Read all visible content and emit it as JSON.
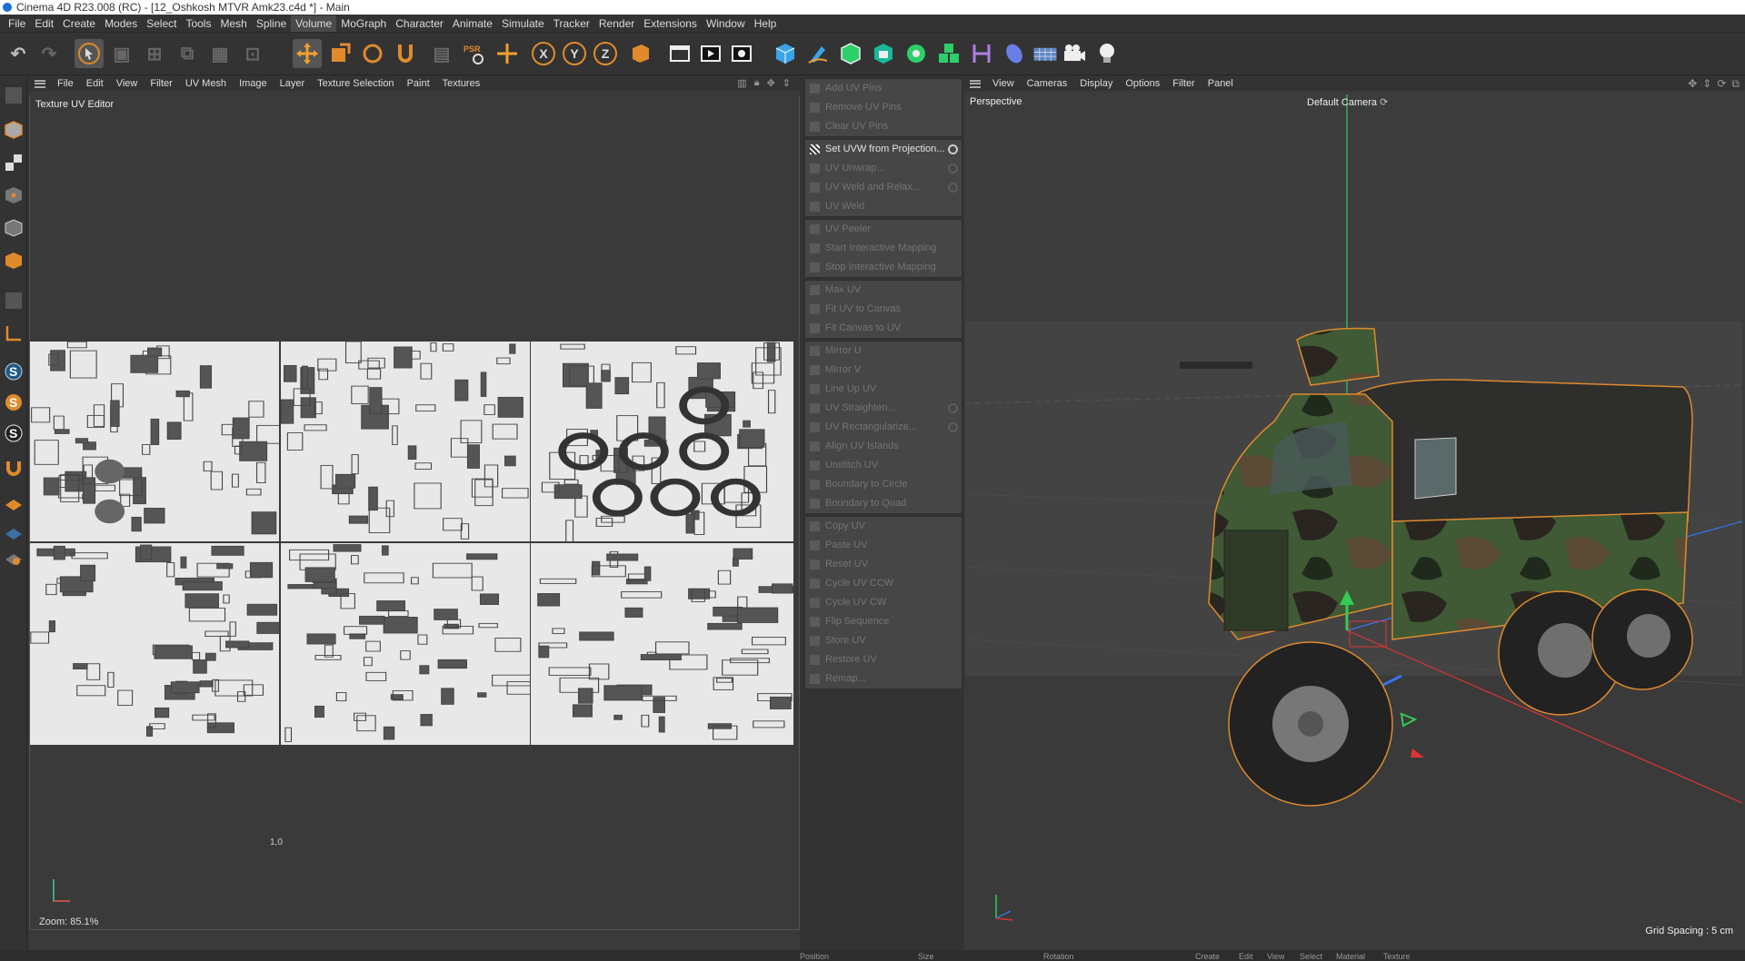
{
  "window": {
    "title": "Cinema 4D R23.008 (RC) - [12_Oshkosh MTVR Amk23.c4d *] - Main"
  },
  "menubar": {
    "items": [
      "File",
      "Edit",
      "Create",
      "Modes",
      "Select",
      "Tools",
      "Mesh",
      "Spline",
      "Volume",
      "MoGraph",
      "Character",
      "Animate",
      "Simulate",
      "Tracker",
      "Render",
      "Extensions",
      "Window",
      "Help"
    ],
    "active": "Volume"
  },
  "toolbar": {
    "axis_x": "X",
    "axis_y": "Y",
    "axis_z": "Z",
    "icons": [
      "undo-icon",
      "redo-icon",
      "live-selection-icon",
      "cube-mode-icon",
      "points-mode-icon",
      "edges-mode-icon",
      "polygons-mode-icon",
      "uv-mode-icon",
      "move-icon",
      "scale-icon",
      "rotate-icon",
      "snap-icon",
      "model-mode-icon",
      "psr-icon",
      "world-axis-icon",
      "render-region-icon",
      "render-view-icon",
      "render-settings-icon",
      "cube-icon",
      "pen-icon",
      "subdivision-icon",
      "extrude-icon",
      "cloner-icon",
      "mograph-icon",
      "deformer-icon",
      "field-icon",
      "floor-icon",
      "camera-icon",
      "light-icon"
    ]
  },
  "uv_editor": {
    "menu": [
      "File",
      "Edit",
      "View",
      "Filter",
      "UV Mesh",
      "Image",
      "Layer",
      "Texture Selection",
      "Paint",
      "Textures"
    ],
    "title": "Texture UV Editor",
    "coord_label": "1,0",
    "zoom": "Zoom: 85.1%"
  },
  "uv_commands": {
    "groups": [
      [
        {
          "label": "Add UV Pins",
          "enabled": false
        },
        {
          "label": "Remove UV Pins",
          "enabled": false
        },
        {
          "label": "Clear UV Pins",
          "enabled": false
        }
      ],
      [
        {
          "label": "Set UVW from Projection...",
          "enabled": true,
          "gear": true
        },
        {
          "label": "UV Unwrap...",
          "enabled": false,
          "gear": true
        },
        {
          "label": "UV Weld and Relax...",
          "enabled": false,
          "gear": true
        },
        {
          "label": "UV Weld",
          "enabled": false
        }
      ],
      [
        {
          "label": "UV Peeler",
          "enabled": false
        },
        {
          "label": "Start Interactive Mapping",
          "enabled": false
        },
        {
          "label": "Stop Interactive Mapping",
          "enabled": false
        }
      ],
      [
        {
          "label": "Max UV",
          "enabled": false
        },
        {
          "label": "Fit UV to Canvas",
          "enabled": false
        },
        {
          "label": "Fit Canvas to UV",
          "enabled": false
        }
      ],
      [
        {
          "label": "Mirror U",
          "enabled": false
        },
        {
          "label": "Mirror V",
          "enabled": false
        },
        {
          "label": "Line Up UV",
          "enabled": false
        },
        {
          "label": "UV Straighten...",
          "enabled": false,
          "gear": true
        },
        {
          "label": "UV Rectangularize...",
          "enabled": false,
          "gear": true
        },
        {
          "label": "Align UV Islands",
          "enabled": false
        },
        {
          "label": "Unstitch UV",
          "enabled": false
        },
        {
          "label": "Boundary to Circle",
          "enabled": false
        },
        {
          "label": "Boundary to Quad",
          "enabled": false
        }
      ],
      [
        {
          "label": "Copy UV",
          "enabled": false
        },
        {
          "label": "Paste UV",
          "enabled": false
        },
        {
          "label": "Reset UV",
          "enabled": false
        },
        {
          "label": "Cycle UV CCW",
          "enabled": false
        },
        {
          "label": "Cycle UV CW",
          "enabled": false
        },
        {
          "label": "Flip Sequence",
          "enabled": false
        },
        {
          "label": "Store UV",
          "enabled": false
        },
        {
          "label": "Restore UV",
          "enabled": false
        },
        {
          "label": "Remap...",
          "enabled": false
        }
      ]
    ]
  },
  "viewport": {
    "menu": [
      "View",
      "Cameras",
      "Display",
      "Options",
      "Filter",
      "Panel"
    ],
    "projection": "Perspective",
    "camera": "Default Camera",
    "grid_spacing": "Grid Spacing : 5 cm"
  },
  "statusbar": {
    "tabs": [
      "Position",
      "Size",
      "Rotation",
      "Create",
      "Edit",
      "View",
      "Select",
      "Material",
      "Texture"
    ]
  },
  "colors": {
    "selection_outline": "#e08a2c",
    "y_axis": "#33cc44",
    "x_axis": "#e03030",
    "z_axis": "#3377ee"
  }
}
